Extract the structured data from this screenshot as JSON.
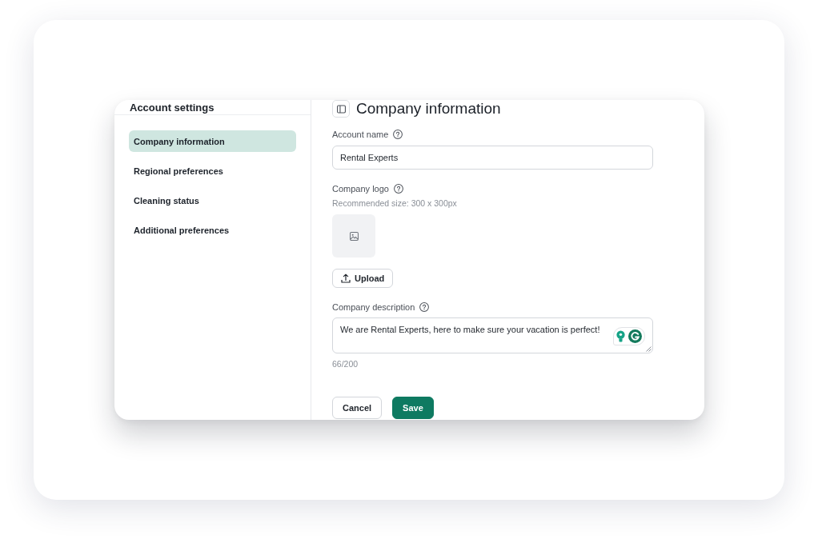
{
  "sidebar": {
    "title": "Account settings",
    "items": [
      {
        "label": "Company information",
        "selected": true
      },
      {
        "label": "Regional preferences",
        "selected": false
      },
      {
        "label": "Cleaning status",
        "selected": false
      },
      {
        "label": "Additional preferences",
        "selected": false
      }
    ]
  },
  "main": {
    "title": "Company information",
    "fields": [
      {
        "kind": "text",
        "label": "Account name",
        "help": true,
        "value": "Rental Experts"
      },
      {
        "kind": "image",
        "label": "Company logo",
        "help": true,
        "hint": "Recommended size: 300 x 300px",
        "button": "Upload"
      },
      {
        "kind": "textarea",
        "label": "Company description",
        "help": true,
        "value": "We are Rental Experts, here to make sure your vacation is perfect!",
        "counter": "66/200"
      }
    ],
    "actions": [
      {
        "label": "Cancel",
        "kind": "secondary"
      },
      {
        "label": "Save",
        "kind": "primary"
      }
    ]
  }
}
